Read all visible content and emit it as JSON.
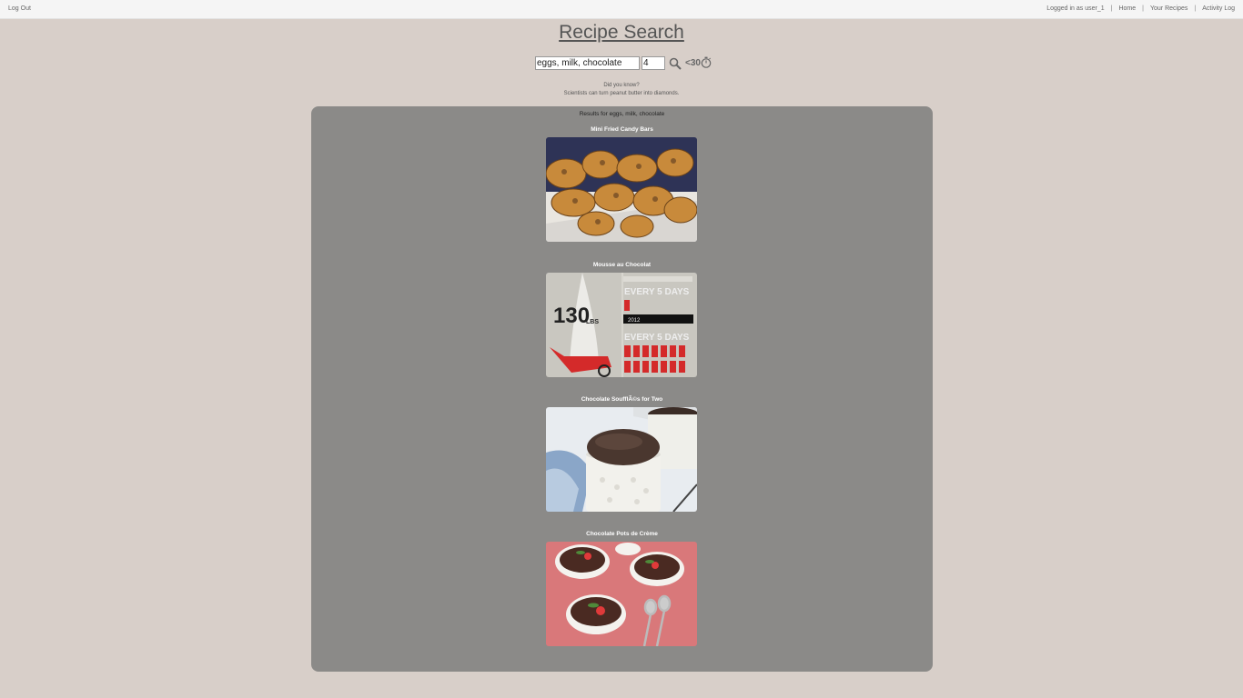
{
  "topbar": {
    "logout": "Log Out",
    "logged_in": "Logged in as user_1",
    "home": "Home",
    "your_recipes": "Your Recipes",
    "activity_log": "Activity Log",
    "separator": "|"
  },
  "page": {
    "title": "Recipe Search"
  },
  "search": {
    "query": "eggs, milk, chocolate",
    "count": "4",
    "timer_label": "<30"
  },
  "fact": {
    "heading": "Did you know?",
    "text": "Scientists can turn peanut butter into diamonds."
  },
  "results": {
    "heading": "Results for eggs, milk, chocolate",
    "items": [
      {
        "title": "Mini Fried Candy Bars"
      },
      {
        "title": "Mousse au Chocolat",
        "infographic": {
          "weight": "130",
          "unit": "LBS",
          "line1": "EVERY 5 DAYS",
          "year": "2012",
          "line2": "EVERY 5 DAYS"
        }
      },
      {
        "title": "Chocolate SoufflÃ©s for Two"
      },
      {
        "title": "Chocolate Pots de Crème"
      }
    ]
  },
  "colors": {
    "page_bg": "#d8cfc9",
    "panel_bg": "#8b8a88",
    "topbar_bg": "#f5f5f5"
  },
  "icons": {
    "search": "search-icon",
    "timer": "stopwatch-icon"
  }
}
